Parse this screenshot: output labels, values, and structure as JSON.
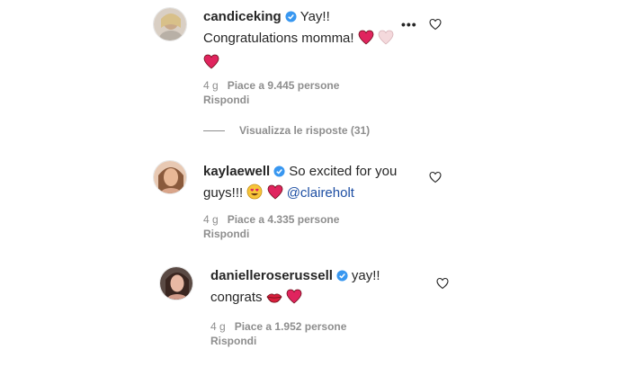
{
  "comments": [
    {
      "username": "candiceking",
      "text_line1": "Yay!!",
      "text_line2": "Congratulations momma!",
      "age": "4 g",
      "likes": "Piace a 9.445 persone",
      "reply": "Rispondi",
      "view_replies": "Visualizza le risposte (31)"
    },
    {
      "username": "kaylaewell",
      "text_line1": "So excited for you",
      "text_line2": "guys!!!",
      "mention": "@claireholt",
      "age": "4 g",
      "likes": "Piace a 4.335 persone",
      "reply": "Rispondi"
    },
    {
      "username": "danielleroserussell",
      "text_line1": "yay!!",
      "text_line2": "congrats",
      "age": "4 g",
      "likes": "Piace a 1.952 persone",
      "reply": "Rispondi"
    }
  ],
  "colors": {
    "verified": "#3897f0",
    "heart_red": "#e0245e",
    "meta_gray": "#8e8e8e",
    "mention_blue": "#1d4ea3"
  },
  "icons": {
    "verified": "verified-badge-icon",
    "like": "heart-outline-icon",
    "more": "more-options-icon"
  }
}
